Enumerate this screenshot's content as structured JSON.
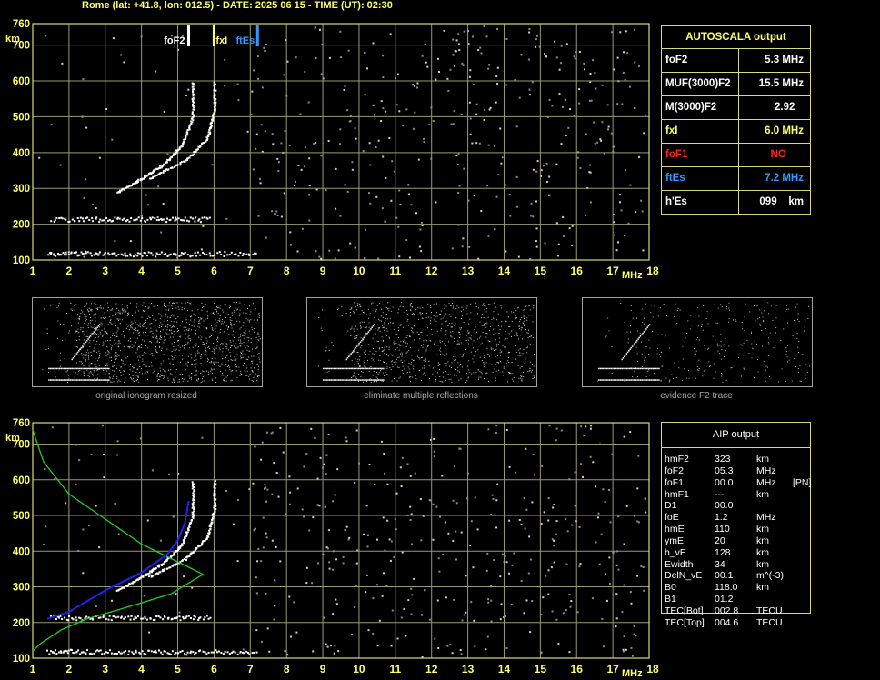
{
  "header": "Rome (lat: +41.8, lon: 012.5) - DATE: 2025 06 15 - TIME (UT): 02:30",
  "colors": {
    "grid": "#9a9a6e",
    "frame": "#d8d880",
    "axis_text": "#ffff66",
    "white": "#ffffff",
    "red": "#ff2020",
    "blue": "#3399ff",
    "yellow": "#ffff66",
    "green": "#22cc22",
    "profile_blue": "#2222ee"
  },
  "chart_data": [
    {
      "type": "scatter",
      "title": "",
      "xlabel": "MHz",
      "ylabel": "km",
      "xlim": [
        1,
        18
      ],
      "ylim": [
        100,
        760
      ],
      "x_ticks": [
        "1",
        "2",
        "3",
        "4",
        "5",
        "6",
        "7",
        "8",
        "9",
        "10",
        "11",
        "12",
        "13",
        "14",
        "15",
        "16",
        "17",
        "18"
      ],
      "y_ticks": [
        "100",
        "200",
        "300",
        "400",
        "500",
        "600",
        "700",
        "760"
      ],
      "grid": true,
      "markers": [
        {
          "label": "foF2",
          "x": 5.3,
          "color": "white"
        },
        {
          "label": "fxI",
          "x": 6.0,
          "color": "yellow"
        },
        {
          "label": "ftEs",
          "x": 7.2,
          "color": "blue"
        }
      ],
      "traces": [
        {
          "name": "",
          "points": [
            [
              1.4,
              120
            ],
            [
              2.5,
              120
            ],
            [
              4,
              118
            ],
            [
              5.5,
              118
            ],
            [
              7.2,
              120
            ]
          ]
        },
        {
          "name": "",
          "points": [
            [
              1.5,
              215
            ],
            [
              3,
              215
            ],
            [
              4.5,
              215
            ],
            [
              5.9,
              215
            ]
          ]
        },
        {
          "name": "",
          "points": [
            [
              3.3,
              290
            ],
            [
              4,
              330
            ],
            [
              4.6,
              370
            ],
            [
              5.1,
              420
            ],
            [
              5.4,
              500
            ],
            [
              5.4,
              600
            ]
          ]
        },
        {
          "name": "",
          "points": [
            [
              4.2,
              330
            ],
            [
              5.2,
              380
            ],
            [
              5.8,
              440
            ],
            [
              6,
              520
            ],
            [
              6,
              600
            ]
          ]
        }
      ]
    },
    {
      "type": "line",
      "title": "",
      "xlabel": "MHz",
      "ylabel": "km",
      "xlim": [
        1,
        18
      ],
      "ylim": [
        100,
        760
      ],
      "x_ticks": [
        "1",
        "2",
        "3",
        "4",
        "5",
        "6",
        "7",
        "8",
        "9",
        "10",
        "11",
        "12",
        "13",
        "14",
        "15",
        "16",
        "17",
        "18"
      ],
      "y_ticks": [
        "100",
        "200",
        "300",
        "400",
        "500",
        "600",
        "700",
        "760"
      ],
      "grid": true,
      "series": [
        {
          "name": "",
          "color": "green",
          "points": [
            [
              1,
              740
            ],
            [
              1.3,
              650
            ],
            [
              2,
              560
            ],
            [
              3,
              490
            ],
            [
              4,
              420
            ],
            [
              5,
              370
            ],
            [
              5.7,
              335
            ],
            [
              4.8,
              280
            ],
            [
              3.5,
              240
            ],
            [
              2.5,
              210
            ],
            [
              1.8,
              180
            ],
            [
              1.2,
              140
            ],
            [
              1,
              120
            ]
          ]
        },
        {
          "name": "",
          "color": "blue",
          "points": [
            [
              1.4,
              210
            ],
            [
              2,
              230
            ],
            [
              3,
              290
            ],
            [
              4,
              340
            ],
            [
              4.7,
              390
            ],
            [
              5,
              430
            ],
            [
              5.2,
              480
            ],
            [
              5.3,
              540
            ]
          ]
        }
      ]
    }
  ],
  "autoscala": {
    "title": "AUTOSCALA output",
    "rows": [
      {
        "label": "foF2",
        "value": "5.3 MHz",
        "color": "#ffffff"
      },
      {
        "label": "MUF(3000)F2",
        "value": "15.5 MHz",
        "color": "#ffffff"
      },
      {
        "label": "M(3000)F2",
        "value": "2.92   ",
        "color": "#ffffff"
      },
      {
        "label": "fxI",
        "value": "6.0 MHz",
        "color": "#ffff66"
      },
      {
        "label": "foF1",
        "value": "NO      ",
        "color": "#ff2020"
      },
      {
        "label": "ftEs",
        "value": "7.2 MHz",
        "color": "#3399ff"
      },
      {
        "label": "h'Es",
        "value": "099    km",
        "color": "#ffffff"
      }
    ]
  },
  "thumbnails": [
    {
      "caption": "original ionogram resized"
    },
    {
      "caption": "eliminate multiple reflections"
    },
    {
      "caption": "evidence F2 trace"
    }
  ],
  "aip": {
    "title": "AIP output",
    "rows": [
      {
        "name": "hmF2",
        "value": "323",
        "unit": "km",
        "extra": ""
      },
      {
        "name": "foF2",
        "value": "05.3",
        "unit": "MHz",
        "extra": ""
      },
      {
        "name": "foF1",
        "value": "00.0",
        "unit": "MHz",
        "extra": "[PN]"
      },
      {
        "name": "hmF1",
        "value": "---",
        "unit": "km",
        "extra": ""
      },
      {
        "name": "D1",
        "value": "00.0",
        "unit": "",
        "extra": ""
      },
      {
        "name": "foE",
        "value": "1.2",
        "unit": "MHz",
        "extra": ""
      },
      {
        "name": "hmE",
        "value": "110",
        "unit": "km",
        "extra": ""
      },
      {
        "name": "ymE",
        "value": "20",
        "unit": "km",
        "extra": ""
      },
      {
        "name": "h_vE",
        "value": "128",
        "unit": "km",
        "extra": ""
      },
      {
        "name": "Ewidth",
        "value": "34",
        "unit": "km",
        "extra": ""
      },
      {
        "name": "DelN_vE",
        "value": "00.1",
        "unit": "m^(-3)",
        "extra": ""
      },
      {
        "name": "B0",
        "value": "118.0",
        "unit": "km",
        "extra": ""
      },
      {
        "name": "B1",
        "value": "01.2",
        "unit": "",
        "extra": ""
      },
      {
        "name": "TEC[Bot]",
        "value": "002.8",
        "unit": "TECU",
        "extra": ""
      },
      {
        "name": "TEC[Top]",
        "value": "004.6",
        "unit": "TECU",
        "extra": ""
      }
    ]
  }
}
